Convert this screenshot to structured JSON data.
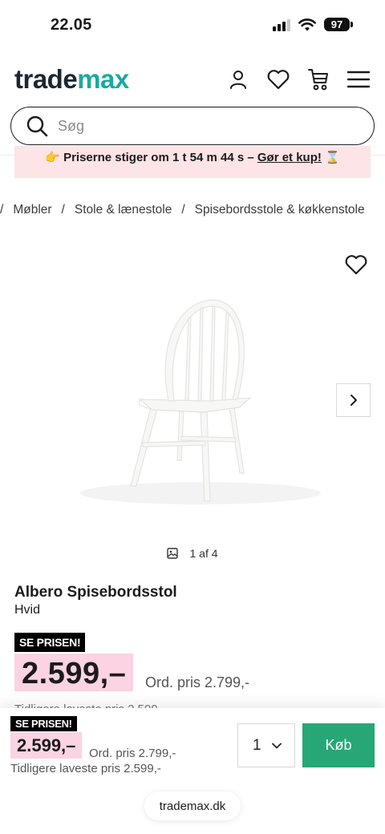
{
  "status_bar": {
    "time": "22.05",
    "battery": "97"
  },
  "header": {
    "logo_part1": "trade",
    "logo_part2": "max"
  },
  "search": {
    "placeholder": "Søg"
  },
  "promo": {
    "text": "👉 Priserne stiger om 1 t 54 m 44 s – ",
    "link": "Gør et kup!",
    "suffix": " ⌛"
  },
  "breadcrumb": [
    "/",
    "Møbler",
    "/",
    "Stole & lænestole",
    "/",
    "Spisebordsstole & køkkenstole"
  ],
  "gallery": {
    "counter": "1 af 4"
  },
  "product": {
    "title": "Albero Spisebordsstol",
    "variant": "Hvid",
    "tag": "SE PRISEN!",
    "price": "2.599,–",
    "ord_price": "Ord. pris 2.799,-",
    "prev_lowest_partial": "Tidligere laveste pris 2.599,-"
  },
  "sticky": {
    "tag": "SE PRISEN!",
    "price": "2.599,–",
    "ord_price": "Ord. pris 2.799,-",
    "prev_lowest": "Tidligere laveste pris 2.599,-",
    "quantity": "1",
    "buy_label": "Køb",
    "url": "trademax.dk"
  },
  "colors": {
    "brand_teal": "#1aa9a1",
    "buy_green": "#27a776",
    "price_pink": "#fbd3e2",
    "promo_pink": "#fde4e6"
  }
}
